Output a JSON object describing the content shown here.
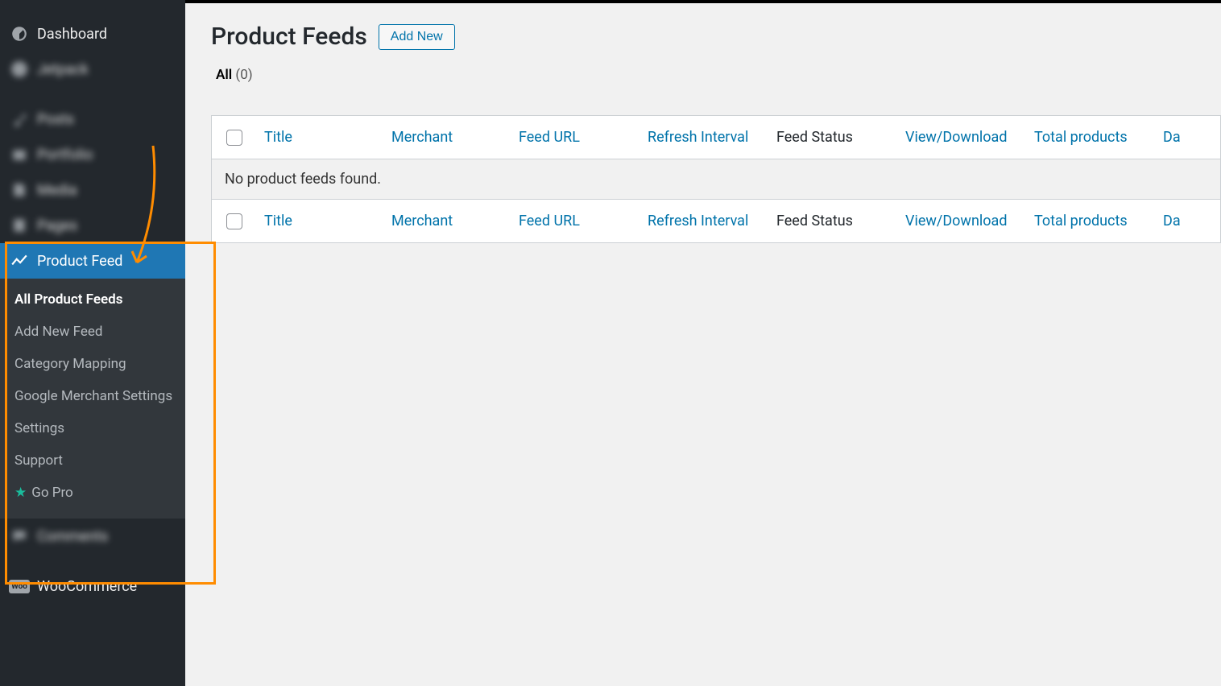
{
  "sidebar": {
    "dashboard": "Dashboard",
    "jetpack": "Jetpack",
    "posts": "Posts",
    "portfolio": "Portfolio",
    "media": "Media",
    "pages": "Pages",
    "product_feed": "Product Feed",
    "submenu": {
      "all": "All Product Feeds",
      "add_new": "Add New Feed",
      "category_mapping": "Category Mapping",
      "google_merchant": "Google Merchant Settings",
      "settings": "Settings",
      "support": "Support",
      "go_pro": "Go Pro"
    },
    "comments": "Comments",
    "woocommerce": "WooCommerce"
  },
  "header": {
    "title": "Product Feeds",
    "add_new": "Add New"
  },
  "filter": {
    "all_label": "All",
    "all_count": "(0)"
  },
  "table": {
    "cols": {
      "title": "Title",
      "merchant": "Merchant",
      "feed_url": "Feed URL",
      "refresh": "Refresh Interval",
      "status": "Feed Status",
      "view": "View/Download",
      "total": "Total products",
      "date": "Da"
    },
    "empty": "No product feeds found."
  }
}
